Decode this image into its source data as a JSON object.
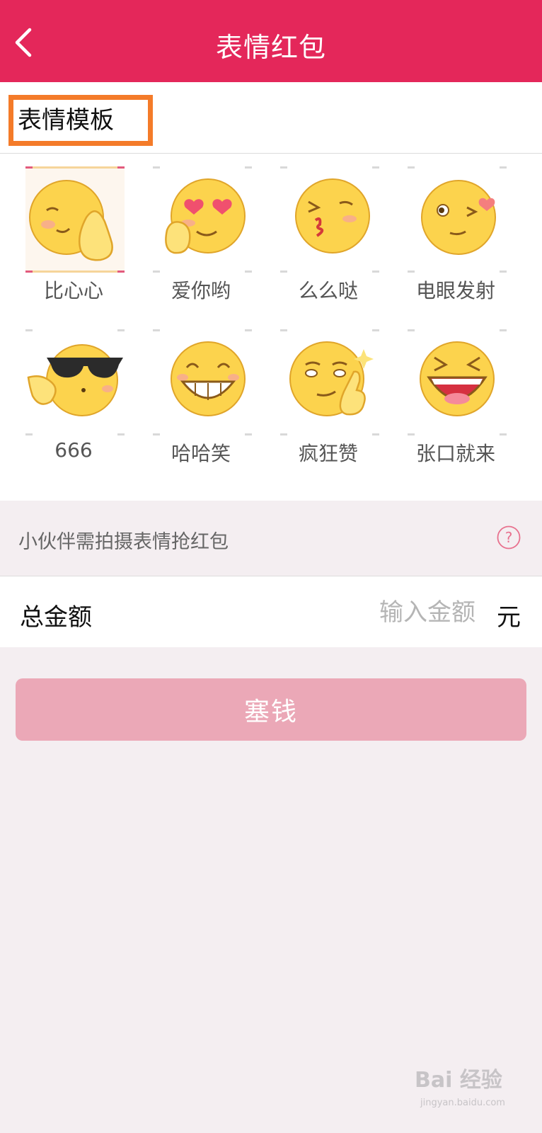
{
  "header": {
    "title": "表情红包"
  },
  "section": {
    "title": "表情模板"
  },
  "templates": [
    {
      "label": "比心心",
      "icon": "heart-hands-emoji-icon"
    },
    {
      "label": "爱你哟",
      "icon": "heart-eyes-emoji-icon"
    },
    {
      "label": "么么哒",
      "icon": "kissing-emoji-icon"
    },
    {
      "label": "电眼发射",
      "icon": "winking-heart-emoji-icon"
    },
    {
      "label": "666",
      "icon": "sunglasses-emoji-icon"
    },
    {
      "label": "哈哈笑",
      "icon": "grinning-emoji-icon"
    },
    {
      "label": "疯狂赞",
      "icon": "thumbs-up-emoji-icon"
    },
    {
      "label": "张口就来",
      "icon": "laughing-emoji-icon"
    }
  ],
  "hint": {
    "text": "小伙伴需拍摄表情抢红包"
  },
  "amount": {
    "label": "总金额",
    "placeholder": "输入金额",
    "value": "",
    "unit": "元"
  },
  "submit": {
    "label": "塞钱"
  },
  "watermark": {
    "main": "Bai 经验",
    "sub": "jingyan.baidu.com"
  },
  "colors": {
    "brand": "#e4275a",
    "highlight_border": "#f47b29",
    "button": "#eba8b7",
    "background": "#f4eef1"
  }
}
